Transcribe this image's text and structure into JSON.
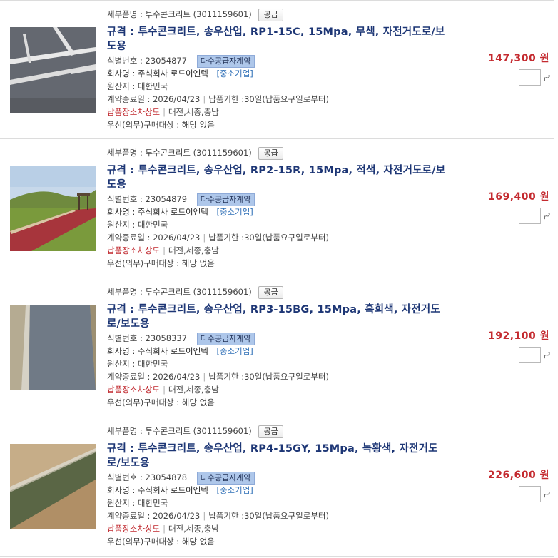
{
  "items": [
    {
      "category_label": "세부품명 : 투수콘크리트",
      "category_code": "(3011159601)",
      "supply_badge": "공급",
      "title": "규격 : 투수콘크리트, 송우산업, RP1-15C, 15Mpa, 무색, 자전거도로/보도용",
      "id_label": "식별번호 : 23054877",
      "contract_badge": "다수공급자계약",
      "company_label": "회사명 : 주식회사 로드이엔텍",
      "company_class": "[중소기업]",
      "origin": "원산지 : 대한민국",
      "contract_end": "계약종료일 : 2026/04/23",
      "delivery_period": "납품기한 :30일(납품요구일로부터)",
      "delivery_place_label": "납품장소차상도",
      "delivery_place": "대전,세종,충남",
      "priority": "우선(의무)구매대상 : 해당 없음",
      "price": "147,300 원",
      "unit": "㎡",
      "thumb_icon": "gray-parking-lot-photo"
    },
    {
      "category_label": "세부품명 : 투수콘크리트",
      "category_code": "(3011159601)",
      "supply_badge": "공급",
      "title": "규격 : 투수콘크리트, 송우산업, RP2-15R, 15Mpa, 적색, 자전거도로/보도용",
      "id_label": "식별번호 : 23054879",
      "contract_badge": "다수공급자계약",
      "company_label": "회사명 : 주식회사 로드이엔텍",
      "company_class": "[중소기업]",
      "origin": "원산지 : 대한민국",
      "contract_end": "계약종료일 : 2026/04/23",
      "delivery_period": "납품기한 :30일(납품요구일로부터)",
      "delivery_place_label": "납품장소차상도",
      "delivery_place": "대전,세종,충남",
      "priority": "우선(의무)구매대상 : 해당 없음",
      "price": "169,400 원",
      "unit": "㎡",
      "thumb_icon": "red-path-photo"
    },
    {
      "category_label": "세부품명 : 투수콘크리트",
      "category_code": "(3011159601)",
      "supply_badge": "공급",
      "title": "규격 : 투수콘크리트, 송우산업, RP3-15BG, 15Mpa, 흑회색, 자전거도로/보도용",
      "id_label": "식별번호 : 23058337",
      "contract_badge": "다수공급자계약",
      "company_label": "회사명 : 주식회사 로드이엔텍",
      "company_class": "[중소기업]",
      "origin": "원산지 : 대한민국",
      "contract_end": "계약종료일 : 2026/04/23",
      "delivery_period": "납품기한 :30일(납품요구일로부터)",
      "delivery_place_label": "납품장소차상도",
      "delivery_place": "대전,세종,충남",
      "priority": "우선(의무)구매대상 : 해당 없음",
      "price": "192,100 원",
      "unit": "㎡",
      "thumb_icon": "dark-gray-path-photo"
    },
    {
      "category_label": "세부품명 : 투수콘크리트",
      "category_code": "(3011159601)",
      "supply_badge": "공급",
      "title": "규격 : 투수콘크리트, 송우산업, RP4-15GY, 15Mpa, 녹황색, 자전거도로/보도용",
      "id_label": "식별번호 : 23054878",
      "contract_badge": "다수공급자계약",
      "company_label": "회사명 : 주식회사 로드이엔텍",
      "company_class": "[중소기업]",
      "origin": "원산지 : 대한민국",
      "contract_end": "계약종료일 : 2026/04/23",
      "delivery_period": "납품기한 :30일(납품요구일로부터)",
      "delivery_place_label": "납품장소차상도",
      "delivery_place": "대전,세종,충남",
      "priority": "우선(의무)구매대상 : 해당 없음",
      "price": "226,600 원",
      "unit": "㎡",
      "thumb_icon": "green-path-photo"
    }
  ],
  "colors": {
    "title": "#1d3675",
    "price": "#c42a2f",
    "place_label": "#c0282e",
    "sme": "#2f6fb7",
    "badge_multi": "#aec7ea"
  }
}
